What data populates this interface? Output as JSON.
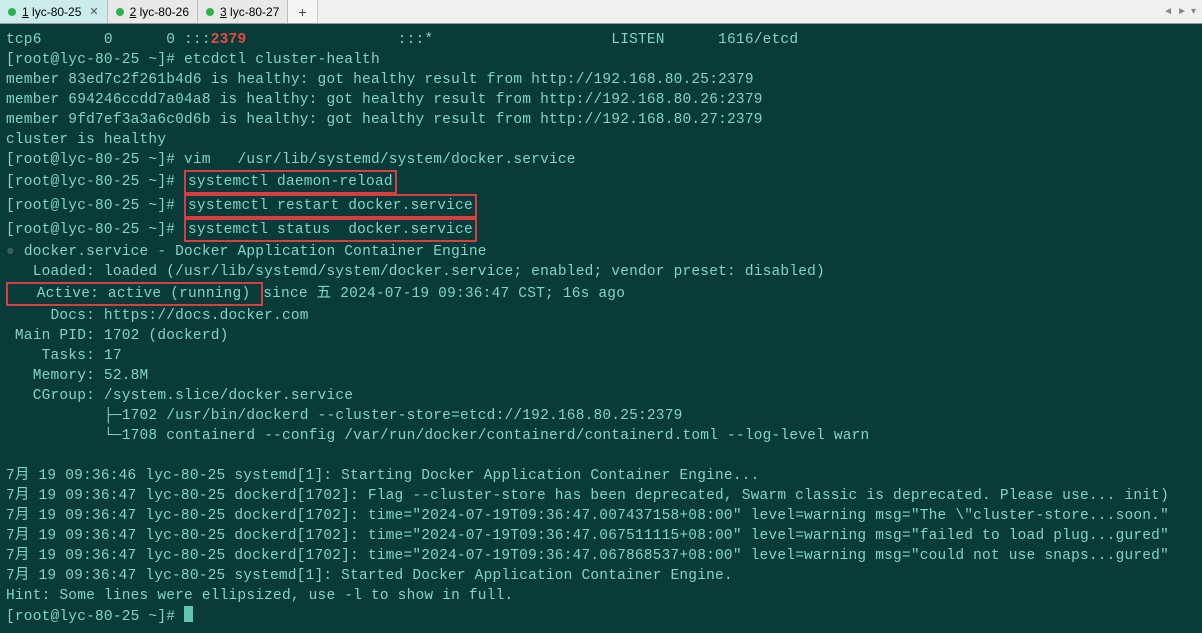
{
  "tabs": [
    {
      "num": "1",
      "name": "lyc-80-25",
      "active": true
    },
    {
      "num": "2",
      "name": "lyc-80-26",
      "active": false
    },
    {
      "num": "3",
      "name": "lyc-80-27",
      "active": false
    }
  ],
  "term": {
    "tcpline_pre": "tcp6       0      0 :::",
    "tcpport": "2379",
    "tcpline_post": "                 :::*                    LISTEN      1616/etcd",
    "prompt": "[root@lyc-80-25 ~]# ",
    "cmd_cluster": "etcdctl cluster-health",
    "m1": "member 83ed7c2f261b4d6 is healthy: got healthy result from http://192.168.80.25:2379",
    "m2": "member 694246ccdd7a04a8 is healthy: got healthy result from http://192.168.80.26:2379",
    "m3": "member 9fd7ef3a3a6c0d6b is healthy: got healthy result from http://192.168.80.27:2379",
    "ch": "cluster is healthy",
    "cmd_vim": "vim   /usr/lib/systemd/system/docker.service",
    "cmd_dr": "systemctl daemon-reload",
    "cmd_re": "systemctl restart docker.service",
    "cmd_st": "systemctl status  docker.service",
    "svc_head": "docker.service - Docker Application Container Engine",
    "svc_loaded": "   Loaded: loaded (/usr/lib/systemd/system/docker.service; enabled; vendor preset: disabled)",
    "svc_active_label": "   Active: ",
    "svc_active_val": "active (running) ",
    "svc_active_rest": "since 五 2024-07-19 09:36:47 CST; 16s ago",
    "svc_docs": "     Docs: https://docs.docker.com",
    "svc_pid": " Main PID: 1702 (dockerd)",
    "svc_tasks": "    Tasks: 17",
    "svc_mem": "   Memory: 52.8M",
    "svc_cgroup": "   CGroup: /system.slice/docker.service",
    "svc_p1": "           ├─1702 /usr/bin/dockerd --cluster-store=etcd://192.168.80.25:2379",
    "svc_p2": "           └─1708 containerd --config /var/run/docker/containerd/containerd.toml --log-level warn",
    "log1": "7月 19 09:36:46 lyc-80-25 systemd[1]: Starting Docker Application Container Engine...",
    "log2": "7月 19 09:36:47 lyc-80-25 dockerd[1702]: Flag --cluster-store has been deprecated, Swarm classic is deprecated. Please use... init)",
    "log3": "7月 19 09:36:47 lyc-80-25 dockerd[1702]: time=\"2024-07-19T09:36:47.007437158+08:00\" level=warning msg=\"The \\\"cluster-store...soon.\"",
    "log4": "7月 19 09:36:47 lyc-80-25 dockerd[1702]: time=\"2024-07-19T09:36:47.067511115+08:00\" level=warning msg=\"failed to load plug...gured\"",
    "log5": "7月 19 09:36:47 lyc-80-25 dockerd[1702]: time=\"2024-07-19T09:36:47.067868537+08:00\" level=warning msg=\"could not use snaps...gured\"",
    "log6": "7月 19 09:36:47 lyc-80-25 systemd[1]: Started Docker Application Container Engine.",
    "hint": "Hint: Some lines were ellipsized, use -l to show in full."
  }
}
